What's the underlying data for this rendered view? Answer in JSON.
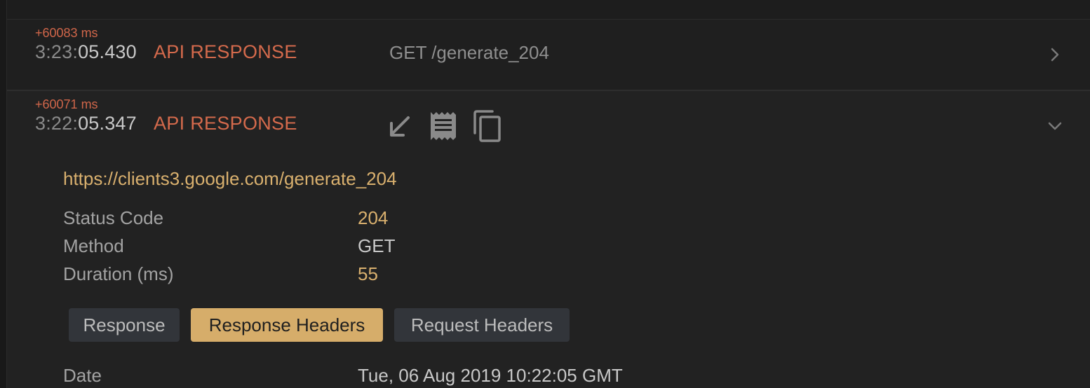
{
  "log_entries": [
    {
      "delta": "+60083 ms",
      "time_prefix": "3:23:",
      "time_main": "05.430",
      "type": "API RESPONSE",
      "summary": "GET /generate_204",
      "expanded": false
    },
    {
      "delta": "+60071 ms",
      "time_prefix": "3:22:",
      "time_main": "05.347",
      "type": "API RESPONSE",
      "expanded": true,
      "actions": [
        {
          "icon": "arrow-down-left-icon"
        },
        {
          "icon": "receipt-icon"
        },
        {
          "icon": "copy-icon"
        }
      ],
      "detail": {
        "url": "https://clients3.google.com/generate_204",
        "fields": [
          {
            "label": "Status Code",
            "value": "204"
          },
          {
            "label": "Method",
            "value": "GET"
          },
          {
            "label": "Duration (ms)",
            "value": "55"
          }
        ],
        "tabs": [
          {
            "label": "Response",
            "active": false
          },
          {
            "label": "Response Headers",
            "active": true
          },
          {
            "label": "Request Headers",
            "active": false
          }
        ],
        "headers": [
          {
            "name": "Date",
            "value": "Tue, 06 Aug 2019 10:22:05 GMT"
          }
        ]
      }
    }
  ],
  "colors": {
    "background": "#1f1f1f",
    "type_accent": "#d46a4c",
    "value_accent": "#d9b06e",
    "tab_active": "#d6ad6a",
    "tab_inactive": "#32353a"
  }
}
